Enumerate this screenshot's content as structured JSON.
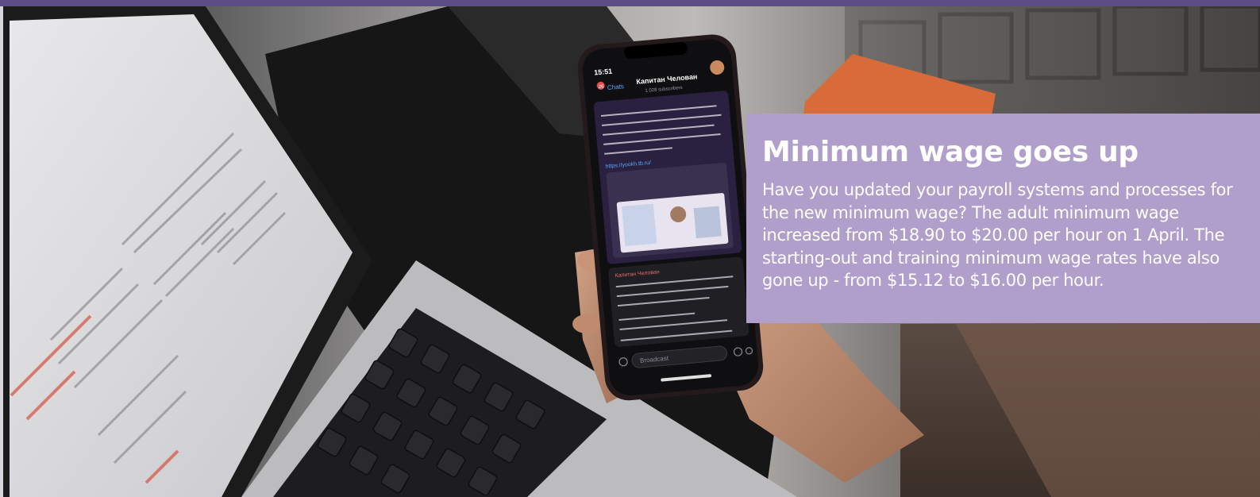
{
  "banner": {
    "title": "Minimum wage goes up",
    "body": "Have you updated your payroll systems and processes for the new minimum wage? The adult minimum wage increased from $18.90 to $20.00 per hour on 1 April. The starting-out and training minimum wage rates have also gone up - from $15.12 to $16.00 per hour."
  },
  "phone_screen": {
    "time": "15:51",
    "back_label": "Chats",
    "unread_badge": "26",
    "channel_name": "Капитан Челован",
    "subscribers": "1 028 subscribers",
    "link": "https://yookh.tb.ru/",
    "sender": "Капитан Челован",
    "input_placeholder": "Broadcast"
  },
  "colors": {
    "top_strip": "#5c4d85",
    "overlay": "#b09ecb",
    "overlay_text": "#ffffff"
  }
}
